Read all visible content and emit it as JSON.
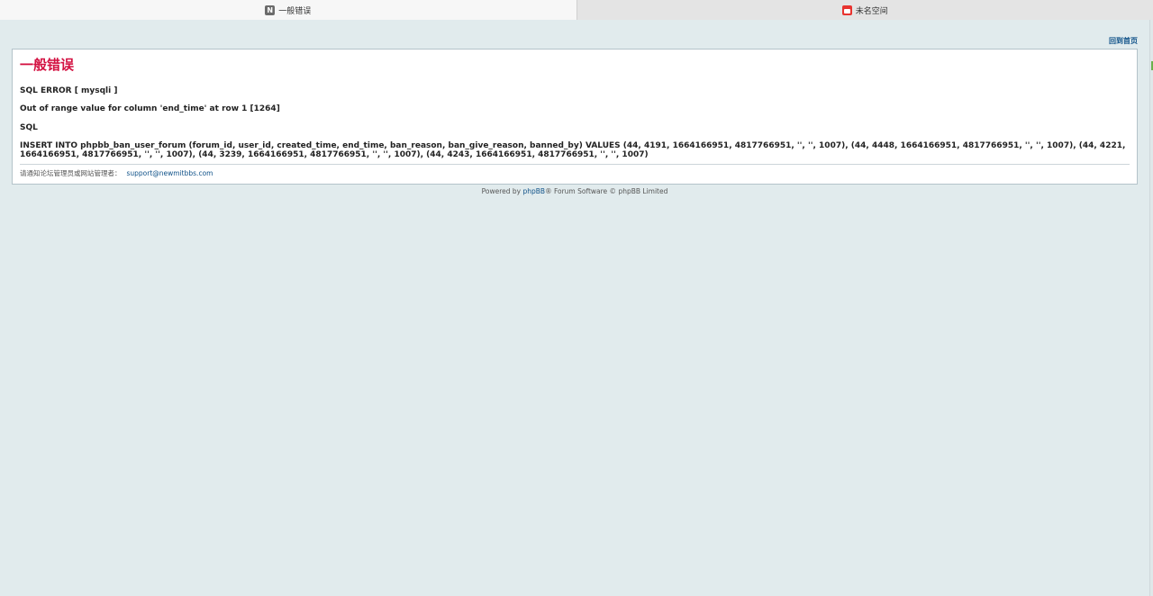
{
  "tabs": [
    {
      "label": "一般错误",
      "icon": "n-letter-icon",
      "active": true
    },
    {
      "label": "未名空间",
      "icon": "calendar-icon",
      "active": false
    }
  ],
  "home_link": "回到首页",
  "error": {
    "title": "一般错误",
    "sql_error": "SQL ERROR [ mysqli ]",
    "message": "Out of range value for column 'end_time' at row 1 [1264]",
    "sql_label": "SQL",
    "query": "INSERT INTO phpbb_ban_user_forum (forum_id, user_id, created_time, end_time, ban_reason, ban_give_reason, banned_by) VALUES (44, 4191, 1664166951, 4817766951, '', '', 1007), (44, 4448, 1664166951, 4817766951, '', '', 1007), (44, 4221, 1664166951, 4817766951, '', '', 1007), (44, 3239, 1664166951, 4817766951, '', '', 1007), (44, 4243, 1664166951, 4817766951, '', '', 1007)",
    "contact_text": "请通知论坛管理员或网站管理者：",
    "contact_email": "support@newmitbbs.com"
  },
  "footer": {
    "prefix": "Powered by ",
    "link": "phpBB",
    "suffix": "® Forum Software © phpBB Limited"
  },
  "colors": {
    "background": "#e1ebed",
    "title": "#d31141",
    "link": "#105289"
  }
}
